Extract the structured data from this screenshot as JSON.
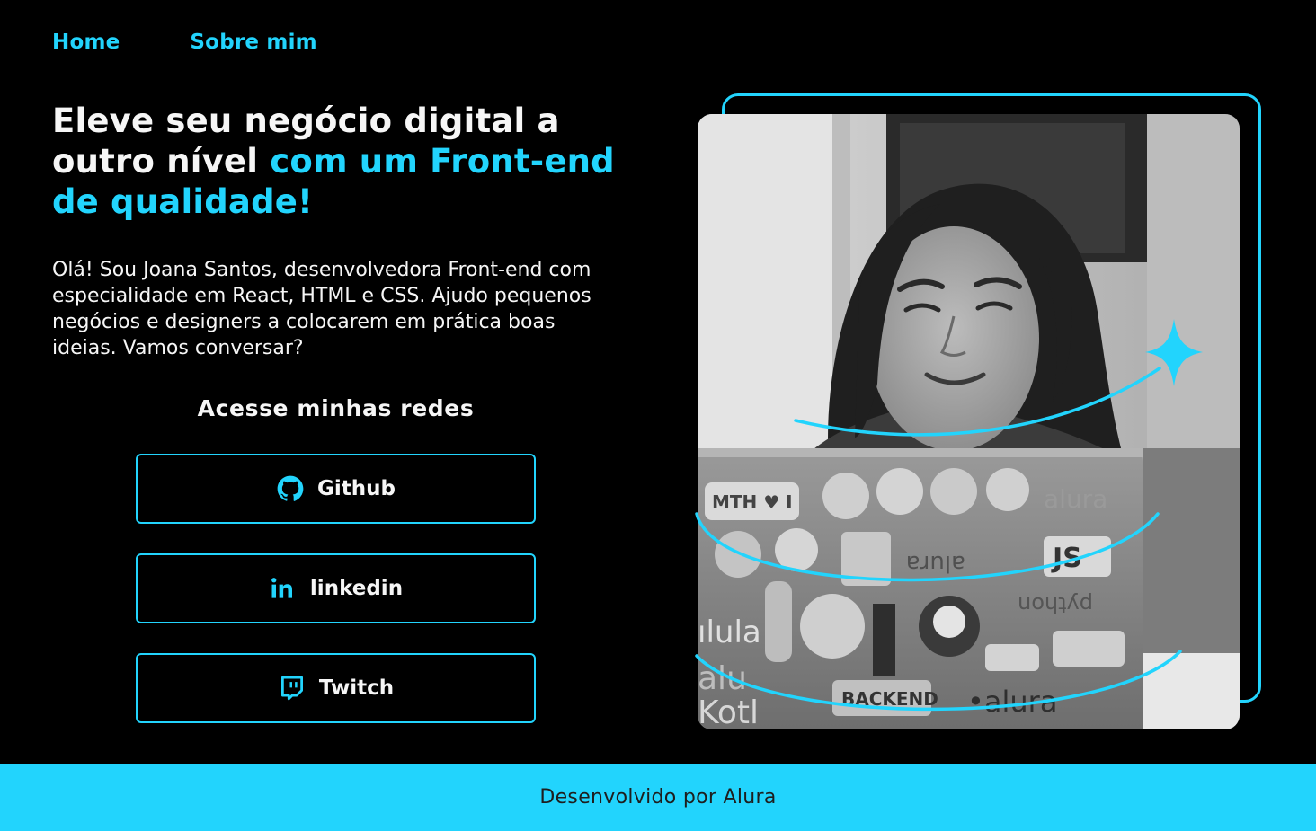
{
  "nav": {
    "home_label": "Home",
    "about_label": "Sobre mim"
  },
  "hero": {
    "headline_part1": "Eleve seu negócio digital a outro nível ",
    "headline_accent": "com um Front-end de qualidade!",
    "bio": "Olá! Sou Joana Santos, desenvolvedora Front-end com especialidade em React, HTML e CSS. Ajudo pequenos negócios e designers a colocarem em prática boas ideias. Vamos conversar?"
  },
  "social": {
    "title": "Acesse minhas redes",
    "buttons": [
      {
        "label": "Github",
        "icon": "github-icon"
      },
      {
        "label": "linkedin",
        "icon": "linkedin-icon"
      },
      {
        "label": "Twitch",
        "icon": "twitch-icon"
      }
    ]
  },
  "footer": {
    "text": "Desenvolvido por Alura"
  },
  "colors": {
    "accent": "#22D4FD",
    "background": "#000000",
    "text": "#F6F6F6"
  }
}
